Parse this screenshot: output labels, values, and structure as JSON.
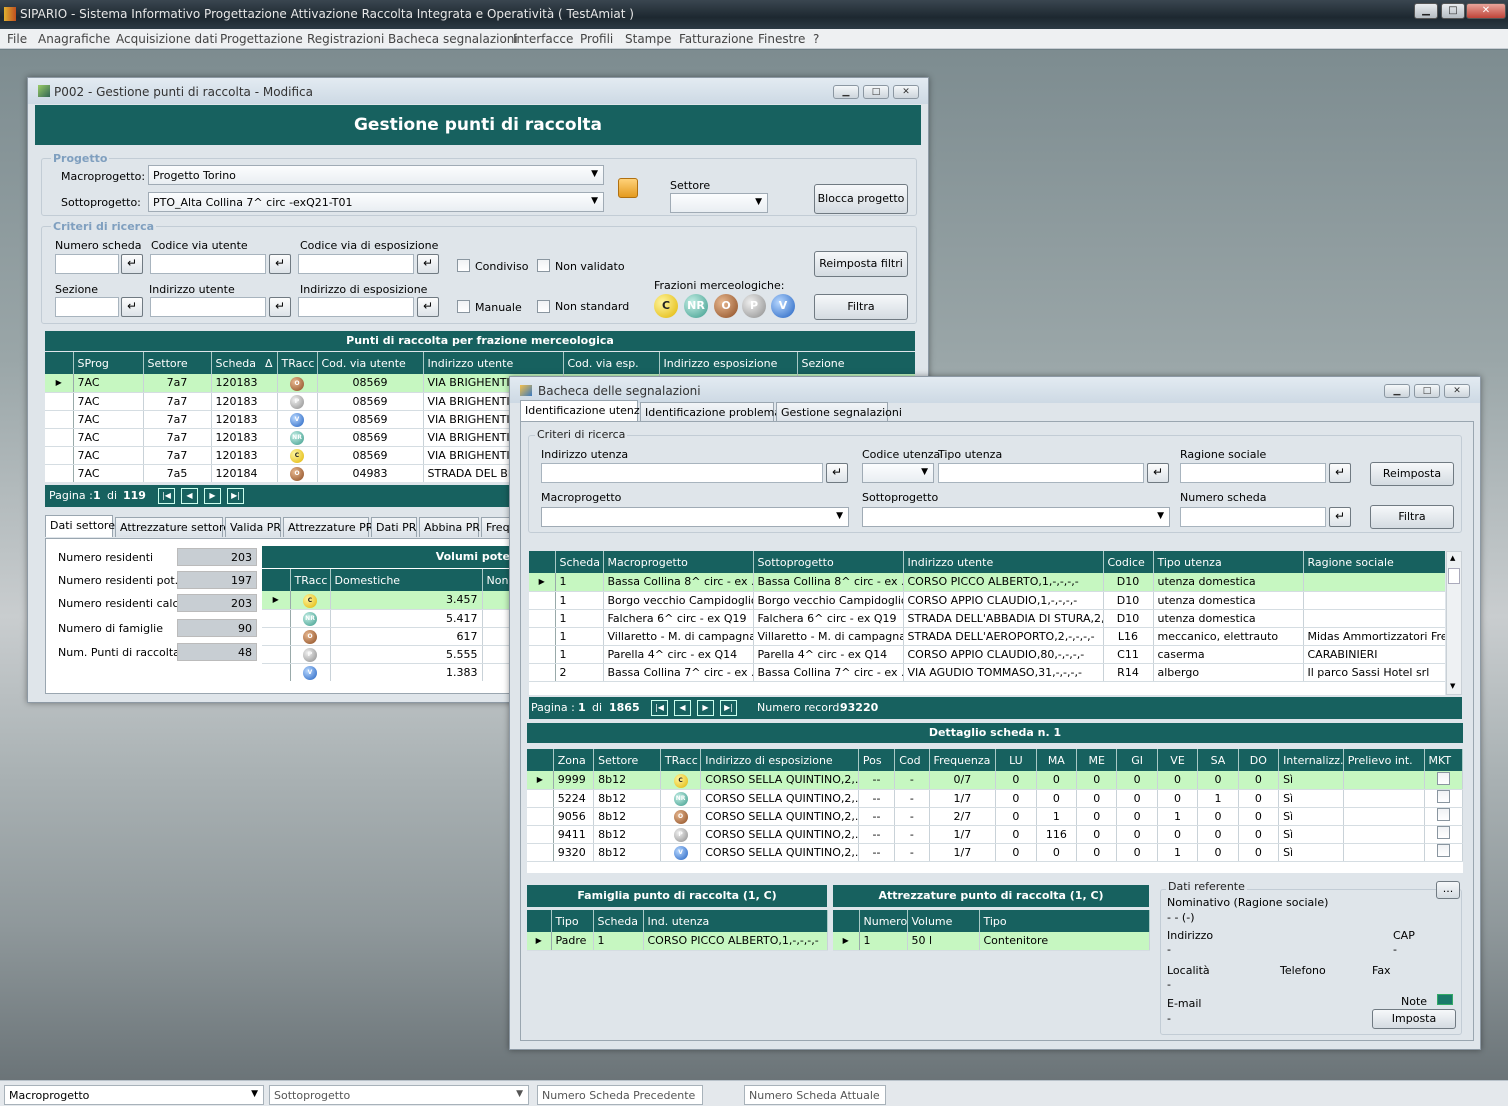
{
  "app": {
    "title": "SIPARIO - Sistema Informativo Progettazione Attivazione Raccolta Integrata e Operatività ( TestAmiat )",
    "min": "▁",
    "max": "□",
    "close": "✕"
  },
  "menu": [
    "File",
    "Anagrafiche",
    "Acquisizione dati",
    "Progettazione",
    "Registrazioni",
    "Bacheca segnalazioni",
    "Interfacce",
    "Profili",
    "Stampe",
    "Fatturazione",
    "Finestre",
    "?"
  ],
  "p002": {
    "title": "P002 - Gestione punti di raccolta - Modifica",
    "header": "Gestione punti di raccolta",
    "progetto_group": "Progetto",
    "macro_label": "Macroprogetto:",
    "macro_value": "Progetto Torino",
    "sotto_label": "Sottoprogetto:",
    "sotto_value": "PTO_Alta Collina 7^ circ -exQ21-T01",
    "settore_label": "Settore",
    "blocca": "Blocca progetto",
    "criteri_group": "Criteri di ricerca",
    "numero_scheda": "Numero scheda",
    "codice_via_utente": "Codice via utente",
    "codice_via_esp": "Codice via di esposizione",
    "condiviso": "Condiviso",
    "non_validato": "Non validato",
    "reimposta": "Reimposta filtri",
    "sezione": "Sezione",
    "indirizzo_utente": "Indirizzo utente",
    "indirizzo_esp": "Indirizzo di esposizione",
    "manuale": "Manuale",
    "non_standard": "Non standard",
    "frazioni": "Frazioni merceologiche:",
    "filtra": "Filtra",
    "frazioni_list": [
      "C",
      "NR",
      "O",
      "P",
      "V"
    ],
    "grid_title": "Punti di raccolta per frazione merceologica",
    "cols": [
      "SProg",
      "Settore",
      "Scheda",
      "TRacc",
      "Cod. via utente",
      "Indirizzo utente",
      "Cod. via esp.",
      "Indirizzo esposizione",
      "Sezione"
    ],
    "sort_icon": "Δ",
    "rows": [
      [
        "7AC",
        "7a7",
        "120183",
        "O",
        "08569",
        "VIA BRIGHENTI"
      ],
      [
        "7AC",
        "7a7",
        "120183",
        "P",
        "08569",
        "VIA BRIGHENTI C"
      ],
      [
        "7AC",
        "7a7",
        "120183",
        "V",
        "08569",
        "VIA BRIGHENTI C"
      ],
      [
        "7AC",
        "7a7",
        "120183",
        "NR",
        "08569",
        "VIA BRIGHENTI C"
      ],
      [
        "7AC",
        "7a7",
        "120183",
        "C",
        "08569",
        "VIA BRIGHENTI C"
      ],
      [
        "7AC",
        "7a5",
        "120184",
        "O",
        "04983",
        "STRADA DEL BEL"
      ]
    ],
    "pager": {
      "label": "Pagina :",
      "page": "1",
      "of": "di",
      "total": "119"
    },
    "tabs": [
      "Dati settore",
      "Attrezzature settore",
      "Valida PR",
      "Attrezzature PR",
      "Dati PR",
      "Abbina PR",
      "Frequ"
    ],
    "stats": [
      {
        "label": "Numero residenti",
        "value": "203"
      },
      {
        "label": "Numero residenti pot.",
        "value": "197"
      },
      {
        "label": "Numero residenti calc.",
        "value": "203"
      },
      {
        "label": "Numero di famiglie",
        "value": "90"
      },
      {
        "label": "Num. Punti di raccolta",
        "value": "48"
      }
    ],
    "volumi_title": "Volumi pote",
    "volumi_cols": [
      "TRacc",
      "Domestiche",
      "Non"
    ],
    "volumi_rows": [
      [
        "C",
        "3.457"
      ],
      [
        "NR",
        "5.417"
      ],
      [
        "O",
        "617"
      ],
      [
        "P",
        "5.555"
      ],
      [
        "V",
        "1.383"
      ]
    ]
  },
  "bacheca": {
    "title": "Bacheca delle segnalazioni",
    "tabs": [
      "Identificazione utenza",
      "Identificazione problema",
      "Gestione segnalazioni"
    ],
    "criteri": "Criteri di ricerca",
    "indirizzo": "Indirizzo utenza",
    "codice": "Codice utenza",
    "tipo": "Tipo utenza",
    "ragione": "Ragione sociale",
    "reimposta": "Reimposta",
    "macro": "Macroprogetto",
    "sotto": "Sottoprogetto",
    "numscheda": "Numero scheda",
    "filtra": "Filtra",
    "cols": [
      "Scheda",
      "Macroprogetto",
      "Sottoprogetto",
      "Indirizzo utente",
      "Codice",
      "Tipo utenza",
      "Ragione sociale"
    ],
    "rows": [
      [
        "1",
        "Bassa Collina 8^ circ - ex ...",
        "Bassa Collina 8^ circ - ex ...",
        "CORSO PICCO ALBERTO,1,-,-,-,-",
        "D10",
        "utenza domestica",
        ""
      ],
      [
        "1",
        "Borgo vecchio Campidoglio...",
        "Borgo vecchio Campidoglio...",
        "CORSO APPIO CLAUDIO,1,-,-,-,-",
        "D10",
        "utenza domestica",
        ""
      ],
      [
        "1",
        "Falchera 6^ circ - ex Q19",
        "Falchera 6^ circ - ex Q19",
        "STRADA DELL'ABBADIA DI STURA,2,...",
        "D10",
        "utenza domestica",
        ""
      ],
      [
        "1",
        "Villaretto - M. di campagna...",
        "Villaretto - M. di campagna...",
        "STRADA DELL'AEROPORTO,2,-,-,-,-",
        "L16",
        "meccanico, elettrauto",
        "Midas Ammortizzatori Freni"
      ],
      [
        "1",
        "Parella 4^ circ - ex Q14",
        "Parella 4^ circ - ex Q14",
        "CORSO APPIO CLAUDIO,80,-,-,-,-",
        "C11",
        "caserma",
        "CARABINIERI"
      ],
      [
        "2",
        "Bassa Collina 7^ circ - ex ...",
        "Bassa Collina 7^ circ - ex ...",
        "VIA AGUDIO TOMMASO,31,-,-,-,-",
        "R14",
        "albergo",
        "Il parco Sassi Hotel srl"
      ]
    ],
    "pager": {
      "label": "Pagina :",
      "page": "1",
      "of": "di",
      "total": "1865",
      "rec_label": "Numero record:",
      "rec": "93220"
    },
    "dettaglio_title": "Dettaglio scheda n. 1",
    "det_cols": [
      "Zona",
      "Settore",
      "TRacc",
      "Indirizzo di esposizione",
      "Pos",
      "Cod",
      "Frequenza",
      "LU",
      "MA",
      "ME",
      "GI",
      "VE",
      "SA",
      "DO",
      "Internalizz.",
      "Prelievo int.",
      "MKT"
    ],
    "det_rows": [
      [
        "9999",
        "8b12",
        "C",
        "CORSO SELLA QUINTINO,2,...",
        "--",
        "-",
        "0/7",
        "0",
        "0",
        "0",
        "0",
        "0",
        "0",
        "0",
        "Sì"
      ],
      [
        "5224",
        "8b12",
        "NR",
        "CORSO SELLA QUINTINO,2,...",
        "--",
        "-",
        "1/7",
        "0",
        "0",
        "0",
        "0",
        "0",
        "1",
        "0",
        "Sì"
      ],
      [
        "9056",
        "8b12",
        "O",
        "CORSO SELLA QUINTINO,2,...",
        "--",
        "-",
        "2/7",
        "0",
        "1",
        "0",
        "0",
        "1",
        "0",
        "0",
        "Sì"
      ],
      [
        "9411",
        "8b12",
        "P",
        "CORSO SELLA QUINTINO,2,...",
        "--",
        "-",
        "1/7",
        "0",
        "116",
        "0",
        "0",
        "0",
        "0",
        "0",
        "Sì"
      ],
      [
        "9320",
        "8b12",
        "V",
        "CORSO SELLA QUINTINO,2,...",
        "--",
        "-",
        "1/7",
        "0",
        "0",
        "0",
        "0",
        "1",
        "0",
        "0",
        "Sì"
      ]
    ],
    "famiglia_title": "Famiglia punto di raccolta (1, C)",
    "fam_cols": [
      "Tipo",
      "Scheda",
      "Ind. utenza"
    ],
    "fam_row": [
      "Padre",
      "1",
      "CORSO PICCO ALBERTO,1,-,-,-,-"
    ],
    "attr_title": "Attrezzature punto di raccolta (1, C)",
    "attr_cols": [
      "Numero",
      "Volume",
      "Tipo"
    ],
    "attr_row": [
      "1",
      "50 l",
      "Contenitore"
    ],
    "ref": {
      "title": "Dati referente",
      "more": "...",
      "nominativo": "Nominativo (Ragione sociale)",
      "nominativo_val": "- - (-)",
      "indirizzo": "Indirizzo",
      "cap": "CAP",
      "localita": "Località",
      "telefono": "Telefono",
      "fax": "Fax",
      "email": "E-mail",
      "note": "Note",
      "dash": "-",
      "imposta": "Imposta"
    }
  },
  "status": {
    "macro": "Macroprogetto",
    "sotto": "Sottoprogetto",
    "prec": "Numero Scheda Precedente",
    "att": "Numero Scheda Attuale"
  }
}
